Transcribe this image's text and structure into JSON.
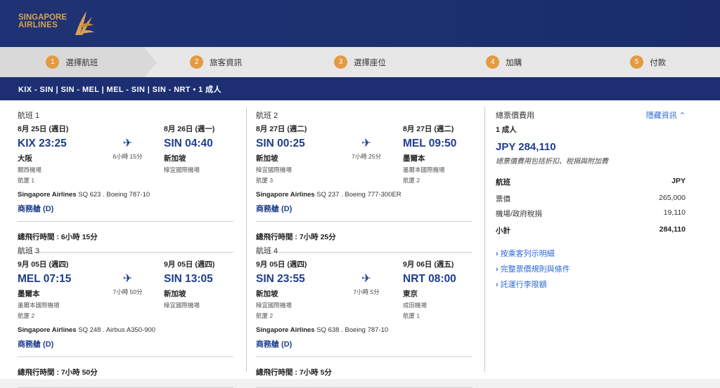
{
  "header": {
    "logo_line1": "SINGAPORE",
    "logo_line2": "AIRLINES"
  },
  "steps": [
    {
      "num": "1",
      "label": "選擇航班"
    },
    {
      "num": "2",
      "label": "旅客資訊"
    },
    {
      "num": "3",
      "label": "選擇座位"
    },
    {
      "num": "4",
      "label": "加購"
    },
    {
      "num": "5",
      "label": "付款"
    }
  ],
  "route_summary": "KIX - SIN  |  SIN - MEL  |  MEL - SIN  |  SIN - NRT  •  1 成人",
  "flights": [
    {
      "title": "航班 1",
      "dep_date": "8月 25日 (週日)",
      "arr_date": "8月 26日 (週一)",
      "dep_time": "KIX 23:25",
      "arr_time": "SIN 04:40",
      "dep_city": "大阪",
      "arr_city": "新加坡",
      "dep_airport": "關西機場",
      "arr_airport": "樟宜國際機場",
      "dep_terminal": "航厦 1",
      "arr_terminal": "",
      "duration": "6小時 15分",
      "carrier_name": "Singapore Airlines",
      "carrier_detail": " SQ 623 . Boeing 787-10",
      "cabin": "商務艙 (D)",
      "total": "總飛行時間 : 6小時 15分"
    },
    {
      "title": "航班 2",
      "dep_date": "8月 27日 (週二)",
      "arr_date": "8月 27日 (週二)",
      "dep_time": "SIN 00:25",
      "arr_time": "MEL 09:50",
      "dep_city": "新加坡",
      "arr_city": "墨爾本",
      "dep_airport": "樟宜國際機場",
      "arr_airport": "墨爾本國際機場",
      "dep_terminal": "航厦 3",
      "arr_terminal": "航厦 2",
      "duration": "7小時 25分",
      "carrier_name": "Singapore Airlines",
      "carrier_detail": " SQ 237 . Boeing 777-300ER",
      "cabin": "商務艙 (D)",
      "total": "總飛行時間 : 7小時 25分"
    },
    {
      "title": "航班 3",
      "dep_date": "9月 05日 (週四)",
      "arr_date": "9月 05日 (週四)",
      "dep_time": "MEL 07:15",
      "arr_time": "SIN 13:05",
      "dep_city": "墨爾本",
      "arr_city": "新加坡",
      "dep_airport": "墨爾本國際機場",
      "arr_airport": "樟宜國際機場",
      "dep_terminal": "航厦 2",
      "arr_terminal": "",
      "duration": "7小時 50分",
      "carrier_name": "Singapore Airlines",
      "carrier_detail": " SQ 248 . Airbus A350-900",
      "cabin": "商務艙 (D)",
      "total": "總飛行時間 : 7小時 50分"
    },
    {
      "title": "航班 4",
      "dep_date": "9月 05日 (週四)",
      "arr_date": "9月 06日 (週五)",
      "dep_time": "SIN 23:55",
      "arr_time": "NRT 08:00",
      "dep_city": "新加坡",
      "arr_city": "東京",
      "dep_airport": "樟宜國際機場",
      "arr_airport": "成田機場",
      "dep_terminal": "航厦 2",
      "arr_terminal": "航厦 1",
      "duration": "7小時 5分",
      "carrier_name": "Singapore Airlines",
      "carrier_detail": " SQ 638 . Boeing 787-10",
      "cabin": "商務艙 (D)",
      "total": "總飛行時間 : 7小時 5分"
    }
  ],
  "price": {
    "heading": "總票價費用",
    "toggle": "隱藏資訊 ⌃",
    "pax": "1 成人",
    "total": "JPY 284,110",
    "note": "總票價費用包括折扣、稅捐與附加費",
    "col_label": "航班",
    "col_currency": "JPY",
    "rows": [
      {
        "label": "票價",
        "value": "265,000"
      },
      {
        "label": "機場/政府稅捐",
        "value": "19,110"
      }
    ],
    "subtotal_label": "小計",
    "subtotal_value": "284,110",
    "links": [
      "按乘客列示明細",
      "完整票價規則與條件",
      "託運行李限額"
    ]
  },
  "colors": {
    "brand_navy": "#1d2f72",
    "accent_gold": "#d8a254",
    "step_orange": "#e49a42",
    "link_blue": "#2c68d0"
  }
}
